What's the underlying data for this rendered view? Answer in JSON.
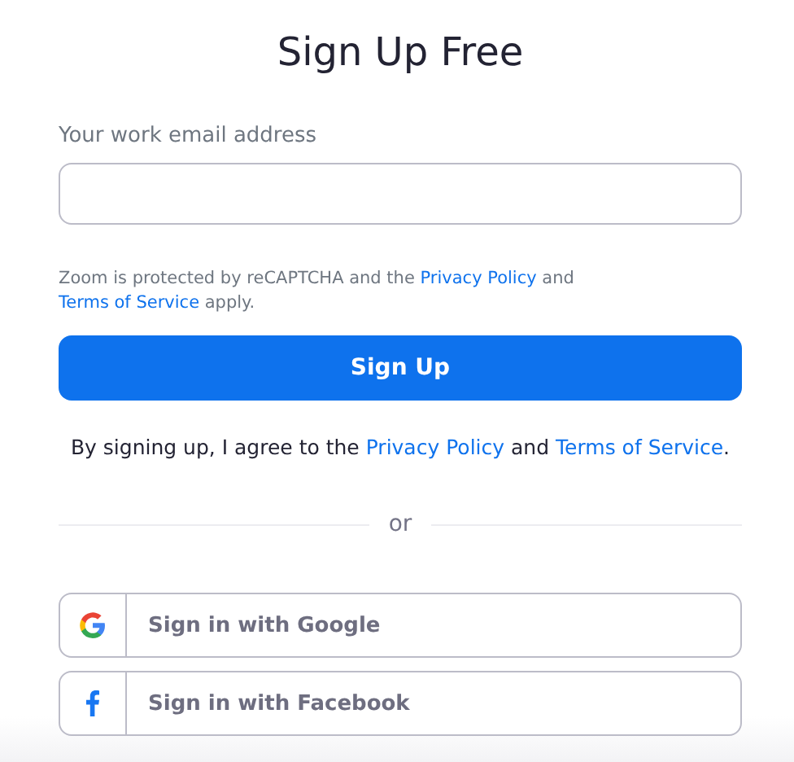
{
  "title": "Sign Up Free",
  "email_field": {
    "label": "Your work email address"
  },
  "recaptcha_note": [
    {
      "kind": "text",
      "text": "Zoom is protected by reCAPTCHA and the "
    },
    {
      "kind": "link",
      "text": "Privacy Policy"
    },
    {
      "kind": "text",
      "text": " and "
    },
    {
      "kind": "link",
      "text": "Terms of Service"
    },
    {
      "kind": "text",
      "text": " apply."
    }
  ],
  "submit_button": "Sign Up",
  "agreement": [
    {
      "kind": "text",
      "text": "By signing up, I agree to the "
    },
    {
      "kind": "link",
      "text": "Privacy Policy"
    },
    {
      "kind": "text",
      "text": " and "
    },
    {
      "kind": "link",
      "text": "Terms of Service"
    },
    {
      "kind": "text",
      "text": "."
    }
  ],
  "divider_text": "or",
  "social_buttons": [
    {
      "kind": "google",
      "label": "Sign in with Google"
    },
    {
      "kind": "facebook",
      "label": "Sign in with Facebook"
    }
  ]
}
